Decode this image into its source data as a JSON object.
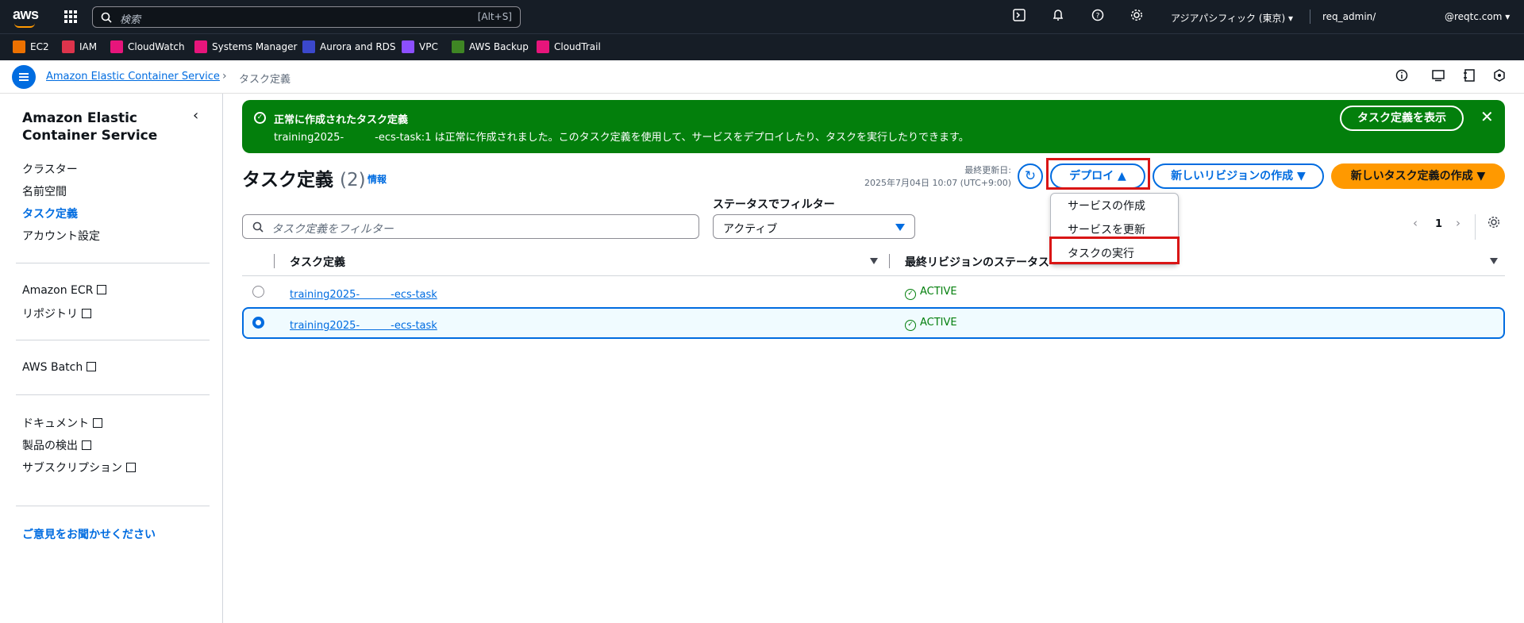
{
  "topbar": {
    "logo": "aws",
    "search_placeholder": "検索",
    "search_shortcut": "[Alt+S]",
    "region": "アジアパシフィック (東京) ▾",
    "user": "req_admin/",
    "domain": "@reqtc.com ▾"
  },
  "favorites": [
    {
      "label": "EC2",
      "color": "#ed7100"
    },
    {
      "label": "IAM",
      "color": "#dd344c"
    },
    {
      "label": "CloudWatch",
      "color": "#e7157b"
    },
    {
      "label": "Systems Manager",
      "color": "#e7157b"
    },
    {
      "label": "Aurora and RDS",
      "color": "#3b48cc"
    },
    {
      "label": "VPC",
      "color": "#8c4fff"
    },
    {
      "label": "AWS Backup",
      "color": "#3f8624"
    },
    {
      "label": "CloudTrail",
      "color": "#e7157b"
    }
  ],
  "breadcrumb": {
    "service": "Amazon Elastic Container Service",
    "current": "タスク定義"
  },
  "sidebar": {
    "title": "Amazon Elastic Container Service",
    "items": [
      "クラスター",
      "名前空間",
      "タスク定義",
      "アカウント設定"
    ],
    "links1": [
      "Amazon ECR",
      "リポジトリ"
    ],
    "links2": [
      "AWS Batch"
    ],
    "links3": [
      "ドキュメント",
      "製品の検出",
      "サブスクリプション"
    ],
    "feedback": "ご意見をお聞かせください"
  },
  "banner": {
    "title": "正常に作成されたタスク定義",
    "body": "training2025-　　　-ecs-task:1 は正常に作成されました。このタスク定義を使用して、サービスをデプロイしたり、タスクを実行したりできます。",
    "view_button": "タスク定義を表示",
    "close": "✕"
  },
  "header": {
    "title": "タスク定義",
    "count": "(2)",
    "info": "情報",
    "last_updated_label": "最終更新日:",
    "last_updated_time": "2025年7月04日 10:07 (UTC+9:00)",
    "deploy_button": "デプロイ",
    "new_revision_button": "新しいリビジョンの作成",
    "new_definition_button": "新しいタスク定義の作成"
  },
  "deploy_menu": [
    "サービスの作成",
    "サービスを更新",
    "タスクの実行"
  ],
  "filter": {
    "placeholder": "タスク定義をフィルター",
    "status_label": "ステータスでフィルター",
    "status_value": "アクティブ"
  },
  "pagination": {
    "page": "1"
  },
  "table": {
    "columns": [
      "タスク定義",
      "最終リビジョンのステータス"
    ],
    "rows": [
      {
        "name": "training2025-　　　-ecs-task",
        "status": "ACTIVE",
        "selected": false
      },
      {
        "name": "training2025-　　　-ecs-task",
        "status": "ACTIVE",
        "selected": true
      }
    ]
  }
}
